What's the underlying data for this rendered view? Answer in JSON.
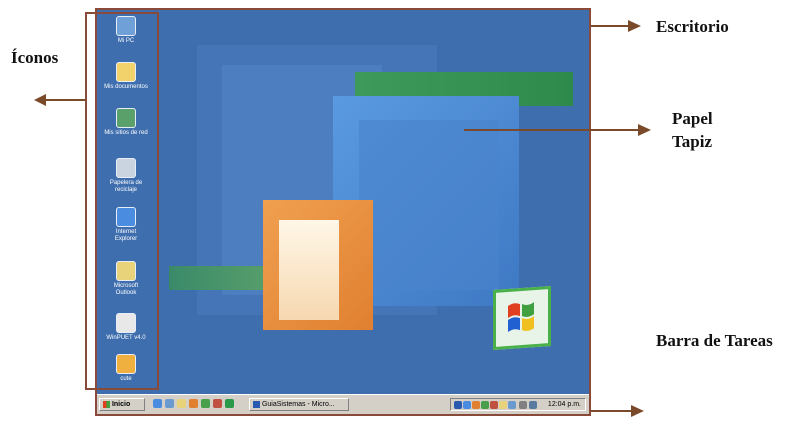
{
  "annotations": {
    "desktop": "Escritorio",
    "icons": "Íconos",
    "wallpaper_line1": "Papel",
    "wallpaper_line2": "Tapiz",
    "taskbar": "Barra de Tareas"
  },
  "desktop_icons": [
    {
      "label": "Mi PC",
      "icon": "computer-icon",
      "color": "#6fa0d8"
    },
    {
      "label": "Mis documentos",
      "icon": "folder-icon",
      "color": "#f2d36b"
    },
    {
      "label": "Mis sitios de red",
      "icon": "network-icon",
      "color": "#5aa06a"
    },
    {
      "label": "Papelera de reciclaje",
      "icon": "recycle-bin-icon",
      "color": "#c9d4e0"
    },
    {
      "label": "Internet Explorer",
      "icon": "ie-icon",
      "color": "#4a8ce0"
    },
    {
      "label": "Microsoft Outlook",
      "icon": "outlook-icon",
      "color": "#e8d27a"
    },
    {
      "label": "WinPUET v4.0",
      "icon": "document-icon",
      "color": "#e8e8e8"
    },
    {
      "label": "cute",
      "icon": "ftp-icon",
      "color": "#f0b040"
    }
  ],
  "taskbar": {
    "start_label": "Inicio",
    "window_button_label": "GuiaSistemas - Micro...",
    "clock": "12:04 p.m."
  },
  "colors": {
    "desktop_bg": "#3e6eae",
    "frame": "#8a4a3a",
    "taskbar": "#d4d0c8"
  }
}
